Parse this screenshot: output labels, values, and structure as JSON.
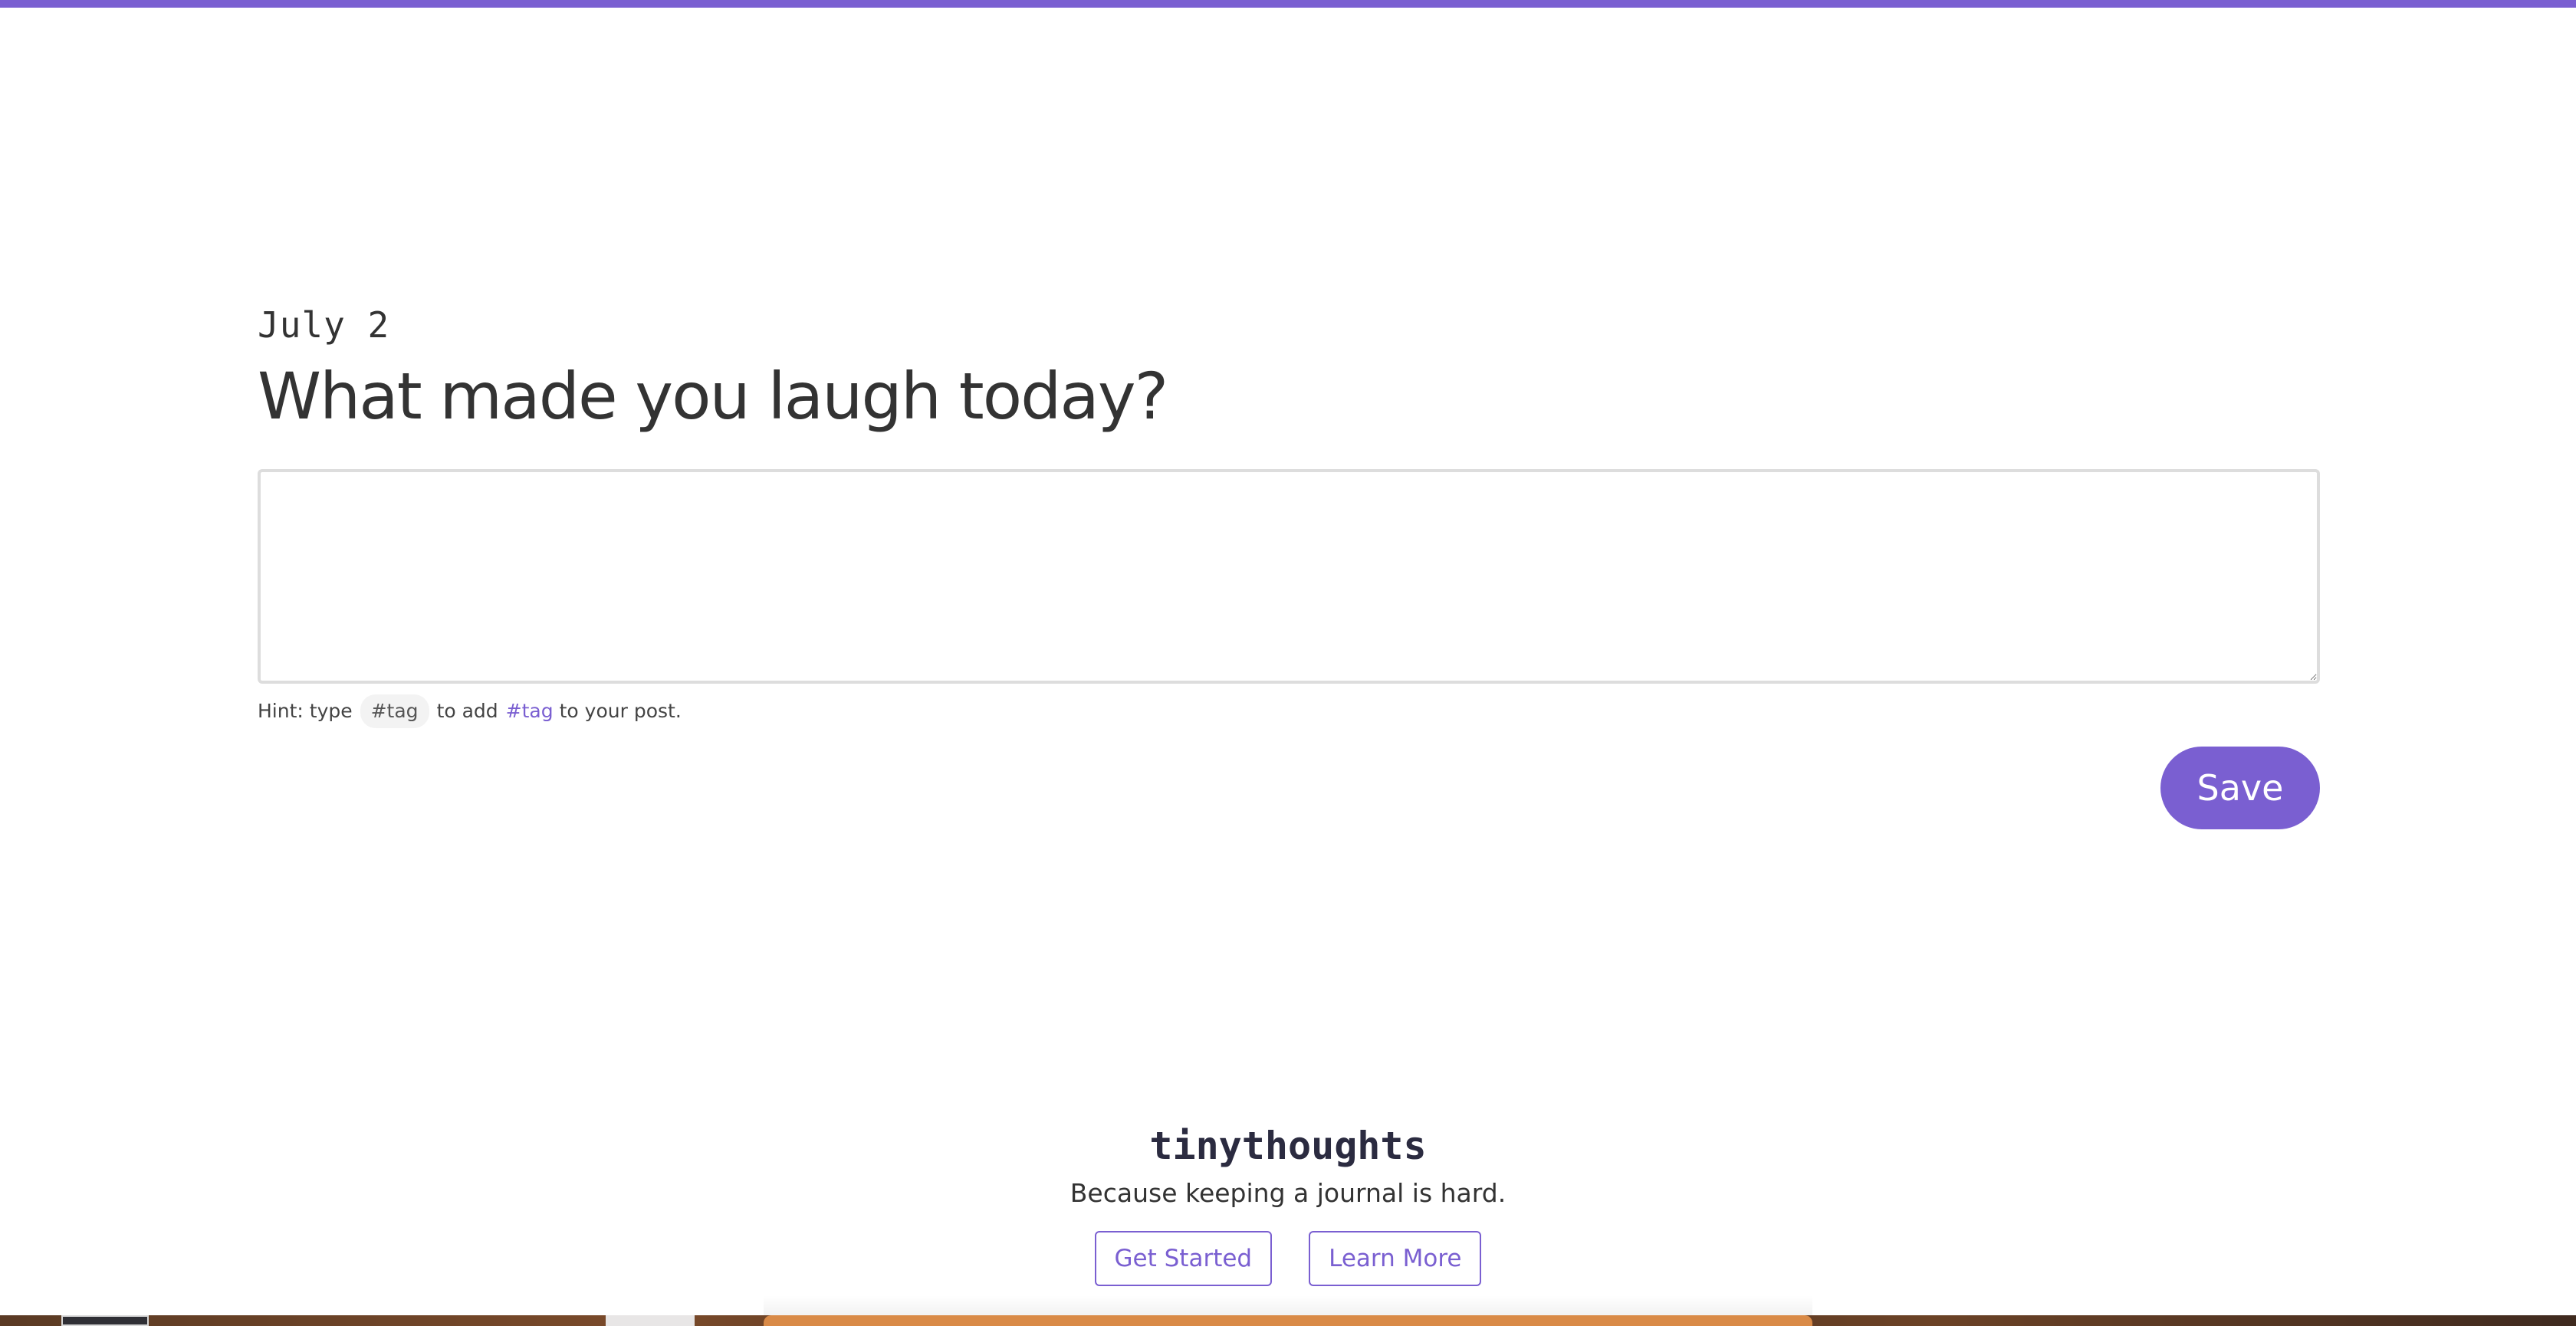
{
  "entry": {
    "date": "July 2",
    "prompt": "What made you laugh today?",
    "textarea_value": "",
    "textarea_placeholder": ""
  },
  "hint": {
    "prefix": "Hint: type",
    "chip": "#tag",
    "middle": "to add",
    "link": "#tag",
    "suffix": "to your post."
  },
  "actions": {
    "save_label": "Save"
  },
  "footer": {
    "brand": "tinythoughts",
    "tagline": "Because keeping a journal is hard.",
    "get_started_label": "Get Started",
    "learn_more_label": "Learn More"
  },
  "colors": {
    "accent": "#7a5fd1",
    "text": "#333333",
    "border": "#dddddd"
  }
}
